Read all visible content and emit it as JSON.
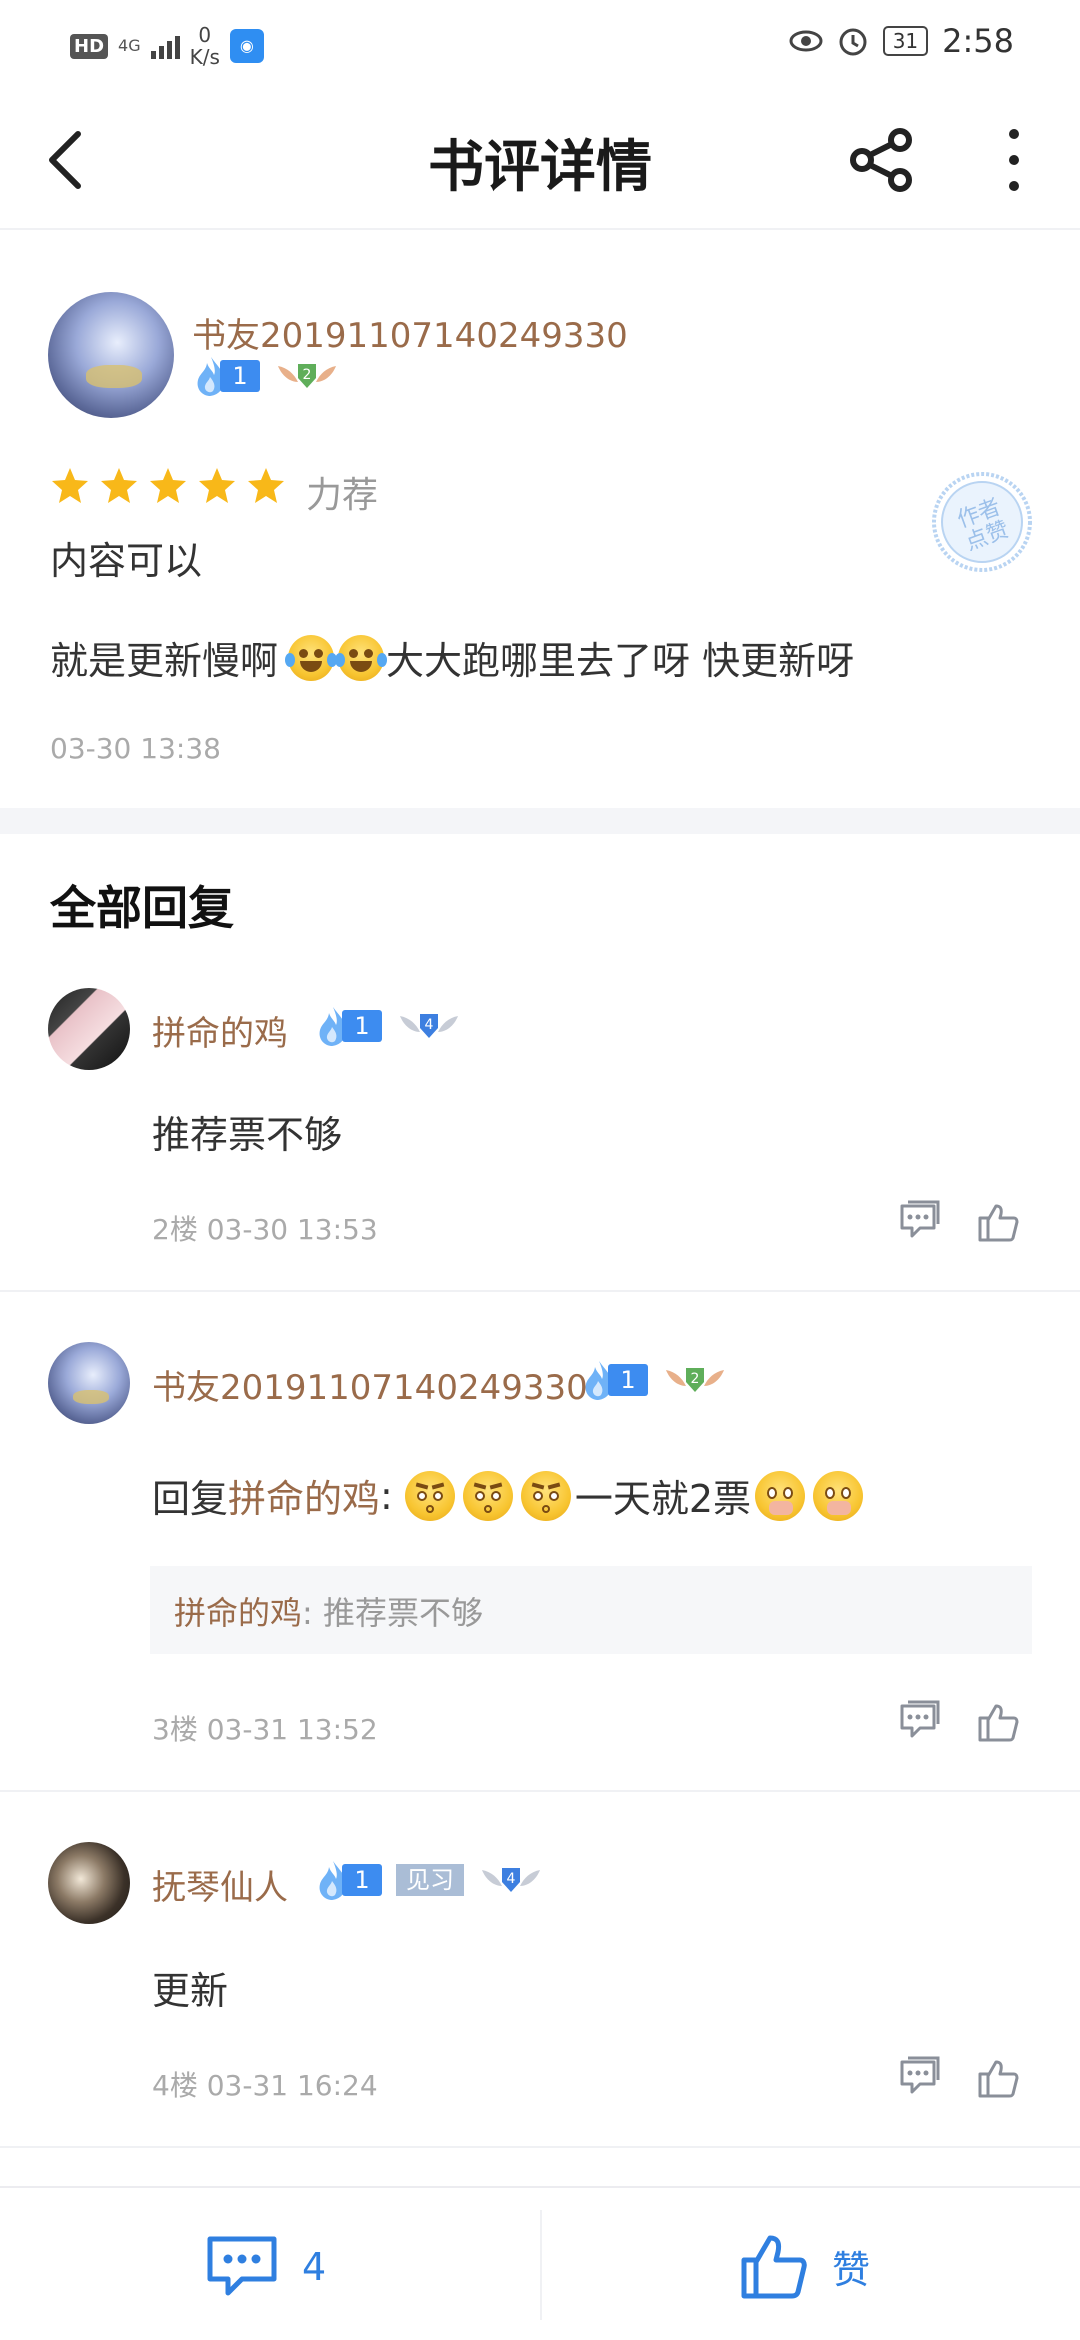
{
  "status_bar": {
    "hd": "HD",
    "network": "4G",
    "speed_value": "0",
    "speed_unit": "K/s",
    "battery": "31",
    "time": "2:58"
  },
  "header": {
    "title": "书评详情",
    "icons": [
      "back-arrow-icon",
      "share-icon",
      "more-vertical-icon"
    ]
  },
  "review": {
    "author": "书友20191107140249330",
    "fan_level": "1",
    "medal_level": "2",
    "rating_stars": 5,
    "rating_label": "力荐",
    "subtitle": "内容可以",
    "body_before": "就是更新慢啊",
    "body_after": "大大跑哪里去了呀 快更新呀",
    "time": "03-30 13:38",
    "stamp_text": "作者点赞"
  },
  "replies_section": {
    "title": "全部回复"
  },
  "replies": [
    {
      "author": "拼命的鸡",
      "fan_level": "1",
      "medal_level": "4",
      "text": "推荐票不够",
      "floor_time": "2楼 03-30 13:53"
    },
    {
      "author": "书友20191107140249330",
      "fan_level": "1",
      "medal_level": "2",
      "reply_prefix": "回复",
      "reply_to": "拼命的鸡",
      "colon": ":",
      "text_mid": "一天就2票",
      "quote_author": "拼命的鸡",
      "quote_text": ": 推荐票不够",
      "floor_time": "3楼 03-31 13:52"
    },
    {
      "author": "抚琴仙人",
      "fan_level": "1",
      "tag": "见习",
      "medal_level": "4",
      "text": "更新",
      "floor_time": "4楼 03-31 16:24"
    }
  ],
  "bottom_bar": {
    "comment_count": "4",
    "like_label": "赞"
  },
  "colors": {
    "accent_blue": "#2f7fe0",
    "username_brown": "#9a6b4a",
    "star_yellow": "#f8b819",
    "muted_gray": "#aaaaaa"
  }
}
